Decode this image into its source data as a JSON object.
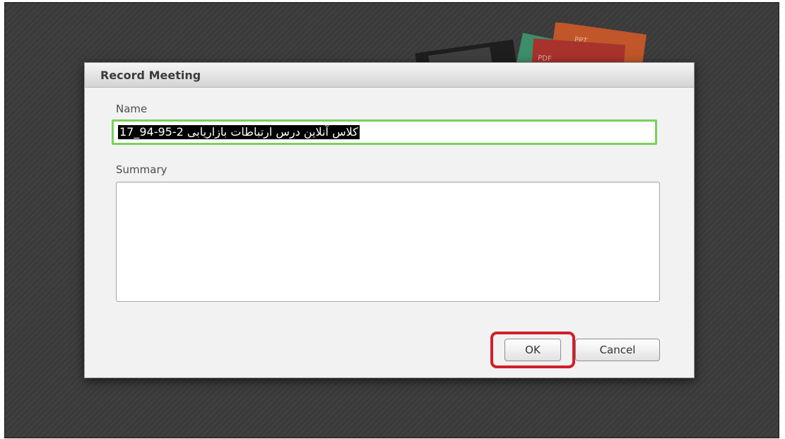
{
  "dialog": {
    "title": "Record Meeting",
    "name_label": "Name",
    "name_value": "کلاس آنلاین درس ارتباطات بازاریابی 2-95-94_17",
    "summary_label": "Summary",
    "summary_value": "",
    "ok_label": "OK",
    "cancel_label": "Cancel"
  },
  "background": {
    "decor_labels": [
      "PPT",
      "PDF"
    ]
  },
  "colors": {
    "background": "#3a3a3a",
    "focus_border": "#7ad15a",
    "highlight": "#d0202a",
    "ppt_doc": "#c0562a",
    "pdf_doc": "#a8322c",
    "slide_doc": "#3d8e6a"
  }
}
